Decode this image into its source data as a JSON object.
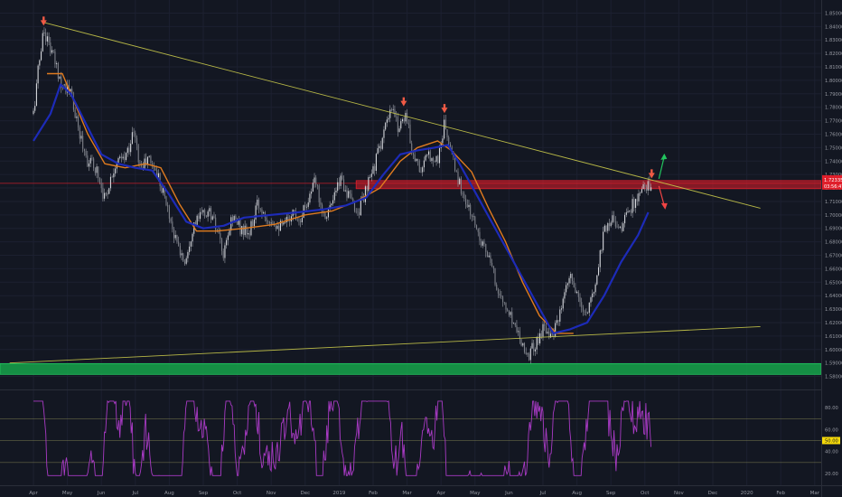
{
  "chart_data": {
    "type": "candlestick",
    "x_axis": {
      "labels": [
        "Apr",
        "May",
        "Jun",
        "Jul",
        "Aug",
        "Sep",
        "Oct",
        "Nov",
        "Dec",
        "2019",
        "Feb",
        "Mar",
        "Apr",
        "May",
        "Jun",
        "Jul",
        "Aug",
        "Sep",
        "Oct",
        "Nov",
        "Dec",
        "2020",
        "Feb",
        "Mar"
      ]
    },
    "price_axis": {
      "ticks": [
        "1.85000",
        "1.84000",
        "1.83000",
        "1.82000",
        "1.81000",
        "1.80000",
        "1.79000",
        "1.78000",
        "1.77000",
        "1.76000",
        "1.75000",
        "1.74000",
        "1.73000",
        "1.72000",
        "1.71000",
        "1.70000",
        "1.69000",
        "1.68000",
        "1.67000",
        "1.66000",
        "1.65000",
        "1.64000",
        "1.63000",
        "1.62000",
        "1.61000",
        "1.60000",
        "1.59000",
        "1.58000"
      ],
      "range": [
        1.575,
        1.855
      ],
      "last_price_label": "1.72335",
      "countdown_label": "03:56:47"
    },
    "rsi_axis": {
      "ticks": [
        "80.00",
        "60.00",
        "40.00",
        "20.00"
      ],
      "range": [
        10,
        95
      ],
      "current_value_label": "50.00",
      "levels": [
        70,
        50,
        30
      ]
    },
    "price_path": [
      {
        "month": 0.0,
        "price": 1.775
      },
      {
        "month": 0.15,
        "price": 1.81
      },
      {
        "month": 0.3,
        "price": 1.838
      },
      {
        "month": 0.55,
        "price": 1.82
      },
      {
        "month": 0.8,
        "price": 1.8
      },
      {
        "month": 1.1,
        "price": 1.79
      },
      {
        "month": 1.3,
        "price": 1.765
      },
      {
        "month": 1.6,
        "price": 1.74
      },
      {
        "month": 1.85,
        "price": 1.735
      },
      {
        "month": 2.1,
        "price": 1.712
      },
      {
        "month": 2.4,
        "price": 1.738
      },
      {
        "month": 2.7,
        "price": 1.742
      },
      {
        "month": 2.95,
        "price": 1.762
      },
      {
        "month": 3.15,
        "price": 1.735
      },
      {
        "month": 3.4,
        "price": 1.742
      },
      {
        "month": 3.7,
        "price": 1.728
      },
      {
        "month": 3.95,
        "price": 1.705
      },
      {
        "month": 4.2,
        "price": 1.68
      },
      {
        "month": 4.45,
        "price": 1.665
      },
      {
        "month": 4.7,
        "price": 1.692
      },
      {
        "month": 4.95,
        "price": 1.7
      },
      {
        "month": 5.2,
        "price": 1.702
      },
      {
        "month": 5.4,
        "price": 1.688
      },
      {
        "month": 5.6,
        "price": 1.668
      },
      {
        "month": 5.85,
        "price": 1.7
      },
      {
        "month": 6.1,
        "price": 1.69
      },
      {
        "month": 6.35,
        "price": 1.685
      },
      {
        "month": 6.6,
        "price": 1.708
      },
      {
        "month": 6.85,
        "price": 1.7
      },
      {
        "month": 7.1,
        "price": 1.695
      },
      {
        "month": 7.35,
        "price": 1.69
      },
      {
        "month": 7.6,
        "price": 1.702
      },
      {
        "month": 7.85,
        "price": 1.698
      },
      {
        "month": 8.05,
        "price": 1.71
      },
      {
        "month": 8.3,
        "price": 1.725
      },
      {
        "month": 8.55,
        "price": 1.7
      },
      {
        "month": 8.8,
        "price": 1.708
      },
      {
        "month": 9.05,
        "price": 1.728
      },
      {
        "month": 9.3,
        "price": 1.712
      },
      {
        "month": 9.55,
        "price": 1.702
      },
      {
        "month": 9.8,
        "price": 1.718
      },
      {
        "month": 10.05,
        "price": 1.738
      },
      {
        "month": 10.3,
        "price": 1.76
      },
      {
        "month": 10.55,
        "price": 1.778
      },
      {
        "month": 10.75,
        "price": 1.765
      },
      {
        "month": 10.95,
        "price": 1.776
      },
      {
        "month": 11.15,
        "price": 1.748
      },
      {
        "month": 11.4,
        "price": 1.733
      },
      {
        "month": 11.65,
        "price": 1.745
      },
      {
        "month": 11.9,
        "price": 1.74
      },
      {
        "month": 12.1,
        "price": 1.768
      },
      {
        "month": 12.3,
        "price": 1.745
      },
      {
        "month": 12.55,
        "price": 1.722
      },
      {
        "month": 12.8,
        "price": 1.705
      },
      {
        "month": 13.05,
        "price": 1.69
      },
      {
        "month": 13.3,
        "price": 1.675
      },
      {
        "month": 13.55,
        "price": 1.655
      },
      {
        "month": 13.8,
        "price": 1.635
      },
      {
        "month": 14.05,
        "price": 1.625
      },
      {
        "month": 14.3,
        "price": 1.612
      },
      {
        "month": 14.55,
        "price": 1.595
      },
      {
        "month": 14.8,
        "price": 1.605
      },
      {
        "month": 15.05,
        "price": 1.618
      },
      {
        "month": 15.3,
        "price": 1.61
      },
      {
        "month": 15.55,
        "price": 1.63
      },
      {
        "month": 15.8,
        "price": 1.655
      },
      {
        "month": 16.05,
        "price": 1.635
      },
      {
        "month": 16.3,
        "price": 1.625
      },
      {
        "month": 16.55,
        "price": 1.65
      },
      {
        "month": 16.8,
        "price": 1.69
      },
      {
        "month": 17.05,
        "price": 1.698
      },
      {
        "month": 17.3,
        "price": 1.69
      },
      {
        "month": 17.55,
        "price": 1.705
      },
      {
        "month": 17.8,
        "price": 1.712
      },
      {
        "month": 18.05,
        "price": 1.722
      },
      {
        "month": 18.2,
        "price": 1.7235
      }
    ],
    "ma_slow": [
      {
        "month": 0.4,
        "price": 1.805
      },
      {
        "month": 0.85,
        "price": 1.805
      },
      {
        "month": 1.1,
        "price": 1.79
      },
      {
        "month": 1.6,
        "price": 1.76
      },
      {
        "month": 2.1,
        "price": 1.738
      },
      {
        "month": 2.7,
        "price": 1.735
      },
      {
        "month": 3.3,
        "price": 1.738
      },
      {
        "month": 3.75,
        "price": 1.735
      },
      {
        "month": 4.3,
        "price": 1.708
      },
      {
        "month": 4.8,
        "price": 1.688
      },
      {
        "month": 5.4,
        "price": 1.688
      },
      {
        "month": 6.2,
        "price": 1.69
      },
      {
        "month": 7.1,
        "price": 1.693
      },
      {
        "month": 8.0,
        "price": 1.7
      },
      {
        "month": 8.8,
        "price": 1.703
      },
      {
        "month": 9.5,
        "price": 1.71
      },
      {
        "month": 10.2,
        "price": 1.72
      },
      {
        "month": 10.8,
        "price": 1.74
      },
      {
        "month": 11.3,
        "price": 1.75
      },
      {
        "month": 11.9,
        "price": 1.755
      },
      {
        "month": 12.3,
        "price": 1.748
      },
      {
        "month": 12.9,
        "price": 1.732
      },
      {
        "month": 13.4,
        "price": 1.705
      },
      {
        "month": 13.9,
        "price": 1.68
      },
      {
        "month": 14.4,
        "price": 1.65
      },
      {
        "month": 14.9,
        "price": 1.625
      },
      {
        "month": 15.4,
        "price": 1.612
      },
      {
        "month": 15.9,
        "price": 1.612
      }
    ],
    "ma_fast": [
      {
        "month": 0.0,
        "price": 1.755
      },
      {
        "month": 0.5,
        "price": 1.775
      },
      {
        "month": 0.8,
        "price": 1.797
      },
      {
        "month": 1.1,
        "price": 1.79
      },
      {
        "month": 1.5,
        "price": 1.77
      },
      {
        "month": 2.0,
        "price": 1.745
      },
      {
        "month": 2.5,
        "price": 1.738
      },
      {
        "month": 3.0,
        "price": 1.735
      },
      {
        "month": 3.5,
        "price": 1.733
      },
      {
        "month": 4.0,
        "price": 1.715
      },
      {
        "month": 4.5,
        "price": 1.695
      },
      {
        "month": 5.0,
        "price": 1.69
      },
      {
        "month": 5.6,
        "price": 1.692
      },
      {
        "month": 6.2,
        "price": 1.698
      },
      {
        "month": 7.0,
        "price": 1.7
      },
      {
        "month": 7.8,
        "price": 1.702
      },
      {
        "month": 8.5,
        "price": 1.704
      },
      {
        "month": 9.2,
        "price": 1.707
      },
      {
        "month": 9.8,
        "price": 1.713
      },
      {
        "month": 10.3,
        "price": 1.73
      },
      {
        "month": 10.8,
        "price": 1.745
      },
      {
        "month": 11.3,
        "price": 1.748
      },
      {
        "month": 11.8,
        "price": 1.75
      },
      {
        "month": 12.2,
        "price": 1.752
      },
      {
        "month": 12.5,
        "price": 1.74
      },
      {
        "month": 15.3,
        "price": 1.612
      },
      {
        "month": 15.8,
        "price": 1.615
      },
      {
        "month": 16.3,
        "price": 1.62
      },
      {
        "month": 16.8,
        "price": 1.64
      },
      {
        "month": 17.3,
        "price": 1.665
      },
      {
        "month": 17.8,
        "price": 1.685
      },
      {
        "month": 18.1,
        "price": 1.702
      }
    ],
    "drawings": {
      "descending_trendline": {
        "p1": {
          "month": 0.3,
          "price": 1.843
        },
        "p2": {
          "month": 21.4,
          "price": 1.705
        }
      },
      "ascending_trendline": {
        "p1": {
          "month": -0.7,
          "price": 1.59
        },
        "p2": {
          "month": 21.4,
          "price": 1.617
        }
      },
      "resistance_zone": {
        "month_start": 9.5,
        "price_low": 1.7195,
        "price_high": 1.7255
      },
      "resistance_line_price": 1.7235,
      "support_zone": {
        "price_low": 1.5815,
        "price_high": 1.5895
      },
      "peak_markers": [
        {
          "month": 0.3,
          "price": 1.838
        },
        {
          "month": 10.9,
          "price": 1.778
        },
        {
          "month": 12.1,
          "price": 1.773
        },
        {
          "month": 18.2,
          "price": 1.7245
        }
      ],
      "scenario_arrows": [
        {
          "direction": "up",
          "color": "#22c55e"
        },
        {
          "direction": "down",
          "color": "#ef4444"
        }
      ]
    },
    "colors": {
      "background": "#131722",
      "ma_slow": "#e07b1f",
      "ma_fast": "#1d2bb8",
      "trendline": "#c8c84a",
      "resistance": "#e01e2a",
      "support": "#16a34a",
      "rsi": "#a83ac4",
      "candle": "#c9ccd3",
      "marker": "#f05a45"
    }
  }
}
